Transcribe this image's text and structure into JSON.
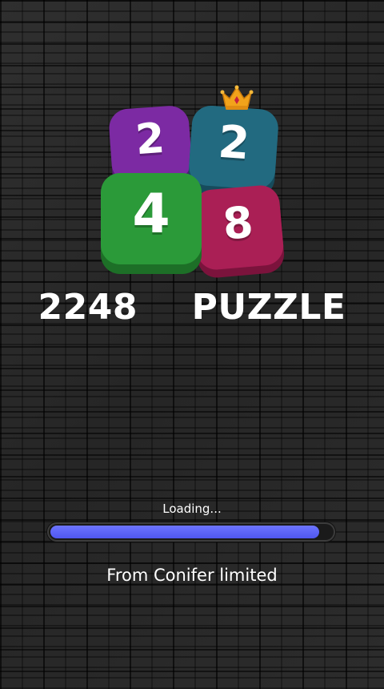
{
  "logo": {
    "tiles": [
      {
        "id": "purple",
        "number": "2",
        "color": "#7c2aa3"
      },
      {
        "id": "teal",
        "number": "2",
        "color": "#226a80"
      },
      {
        "id": "green",
        "number": "4",
        "color": "#2b9a39"
      },
      {
        "id": "crimson",
        "number": "8",
        "color": "#aa1f55"
      }
    ],
    "crown_icon": "crown-icon"
  },
  "title": "2248  PUZZLE",
  "loading": {
    "label": "Loading...",
    "progress": 0.955,
    "bar_color": "#5a62f7"
  },
  "credit": "From Conifer limited"
}
